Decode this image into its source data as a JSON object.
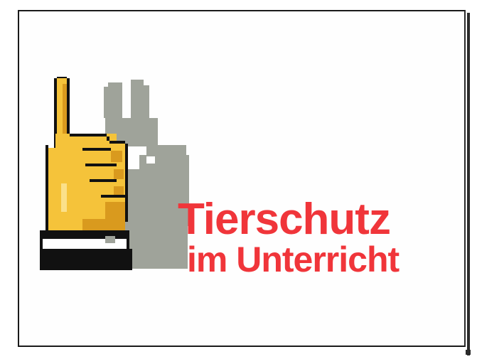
{
  "logo": {
    "icon": "pointing-hand-with-rabbit-shadow",
    "colors": {
      "finger": "#f5c33a",
      "finger_shadow": "#d99a1e",
      "outline": "#111111",
      "shadow": "#9fa39a",
      "cuff": "#ffffff",
      "sleeve": "#111111"
    }
  },
  "title": {
    "line1": "Tierschutz",
    "line2": "im Unterricht",
    "color": "#f0353a"
  }
}
